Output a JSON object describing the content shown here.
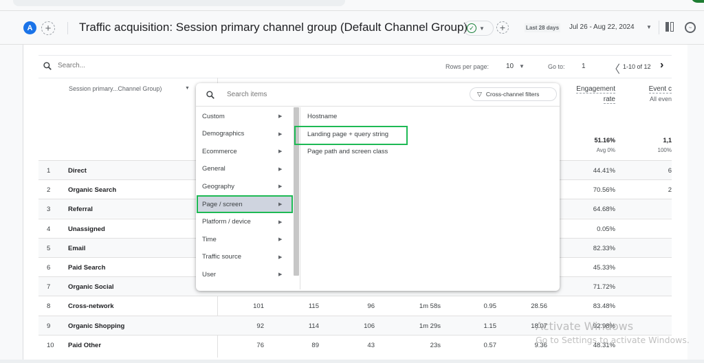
{
  "header": {
    "avatar_letter": "A",
    "title": "Traffic acquisition: Session primary channel group (Default Channel Group)",
    "date_label": "Last 28 days",
    "date_range": "Jul 26 - Aug 22, 2024",
    "icons": [
      "add-comparison-icon",
      "status-check-icon",
      "add-icon",
      "compare-icon",
      "insights-icon"
    ]
  },
  "table_controls": {
    "search_placeholder": "Search...",
    "rows_per_page_label": "Rows per page:",
    "rows_per_page_value": "10",
    "goto_label": "Go to:",
    "goto_value": "1",
    "page_range": "1-10 of 12"
  },
  "table": {
    "dimension_header": "Session primary...Channel Group)",
    "columns": [
      {
        "label_line1": "Engagement",
        "label_line2": "rate",
        "total": "51.16%",
        "sub": "Avg 0%"
      },
      {
        "label_line1": "Event c",
        "label_line2": "All even",
        "total": "1,1",
        "sub": "100%"
      }
    ],
    "rows": [
      {
        "idx": "1",
        "name": "Direct",
        "c1": "",
        "c2": "",
        "c3": "",
        "c4": "",
        "c5": "",
        "c6": "",
        "er": "44.41%",
        "ev": "6"
      },
      {
        "idx": "2",
        "name": "Organic Search",
        "c1": "",
        "c2": "",
        "c3": "",
        "c4": "",
        "c5": "",
        "c6": "",
        "er": "70.56%",
        "ev": "2"
      },
      {
        "idx": "3",
        "name": "Referral",
        "c1": "",
        "c2": "",
        "c3": "",
        "c4": "",
        "c5": "",
        "c6": "",
        "er": "64.68%",
        "ev": ""
      },
      {
        "idx": "4",
        "name": "Unassigned",
        "c1": "",
        "c2": "",
        "c3": "",
        "c4": "",
        "c5": "",
        "c6": "",
        "er": "0.05%",
        "ev": ""
      },
      {
        "idx": "5",
        "name": "Email",
        "c1": "",
        "c2": "",
        "c3": "",
        "c4": "",
        "c5": "",
        "c6": "",
        "er": "82.33%",
        "ev": ""
      },
      {
        "idx": "6",
        "name": "Paid Search",
        "c1": "",
        "c2": "",
        "c3": "",
        "c4": "",
        "c5": "",
        "c6": "",
        "er": "45.33%",
        "ev": ""
      },
      {
        "idx": "7",
        "name": "Organic Social",
        "c1": "",
        "c2": "",
        "c3": "",
        "c4": "",
        "c5": "",
        "c6": "",
        "er": "71.72%",
        "ev": ""
      },
      {
        "idx": "8",
        "name": "Cross-network",
        "c1": "101",
        "c2": "115",
        "c3": "96",
        "c4": "1m 58s",
        "c5": "0.95",
        "c6": "28.56",
        "er": "83.48%",
        "ev": ""
      },
      {
        "idx": "9",
        "name": "Organic Shopping",
        "c1": "92",
        "c2": "114",
        "c3": "106",
        "c4": "1m 29s",
        "c5": "1.15",
        "c6": "18.07",
        "er": "92.98%",
        "ev": ""
      },
      {
        "idx": "10",
        "name": "Paid Other",
        "c1": "76",
        "c2": "89",
        "c3": "43",
        "c4": "23s",
        "c5": "0.57",
        "c6": "9.36",
        "er": "48.31%",
        "ev": ""
      }
    ]
  },
  "dropdown": {
    "search_placeholder": "Search items",
    "cross_channel_label": "Cross-channel filters",
    "categories": [
      "Custom",
      "Demographics",
      "Ecommerce",
      "General",
      "Geography",
      "Page / screen",
      "Platform / device",
      "Time",
      "Traffic source",
      "User"
    ],
    "selected_category": "Page / screen",
    "items": [
      "Hostname",
      "Landing page + query string",
      "Page path and screen class"
    ],
    "highlighted_item": "Landing page + query string",
    "highlight_color": "#1db954"
  },
  "watermark": {
    "line1": "Activate Windows",
    "line2": "Go to Settings to activate Windows."
  }
}
